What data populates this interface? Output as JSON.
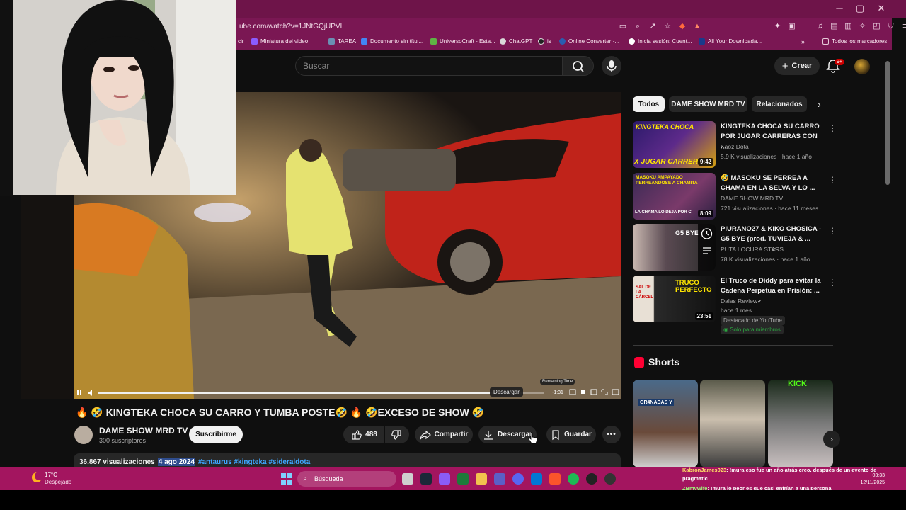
{
  "browser": {
    "url": "ube.com/watch?v=1JNtGQjUPVI",
    "bookmarks": [
      {
        "label": "cir",
        "color": "#ff5c8a"
      },
      {
        "label": "Miniatura del video",
        "color": "#8a5cff"
      },
      {
        "label": "TAREA",
        "color": "#6b8fb3"
      },
      {
        "label": "Documento sin títul...",
        "color": "#4285f4"
      },
      {
        "label": "UniversoCraft - Esta...",
        "color": "#5fb344"
      },
      {
        "label": "ChatGPT",
        "color": "#d8d8d8"
      },
      {
        "label": "is",
        "color": "#222222"
      },
      {
        "label": "Online Converter -...",
        "color": "#2a5db0"
      },
      {
        "label": "Inicia sesión: Cuent...",
        "color": "#ffffff"
      },
      {
        "label": "All Your Downloada...",
        "color": "#1a3a8a"
      },
      {
        "label": "Todos los marcadores",
        "color": "#e6c9d8"
      }
    ],
    "window_controls": {
      "minimize": "─",
      "maximize": "▢",
      "close": "✕"
    }
  },
  "header": {
    "search_placeholder": "Buscar",
    "create_label": "Crear",
    "notification_badge": "9+"
  },
  "player": {
    "tooltip_remaining": "Remaining Time",
    "time_remaining": "-1:31",
    "download_tooltip": "Descargar",
    "progress": 0.88
  },
  "video": {
    "title": "🔥 🤣 KINGTEKA CHOCA SU CARRO Y TUMBA POSTE🤣 🔥 🤣EXCESO DE SHOW 🤣",
    "channel": "DAME SHOW MRD TV",
    "subscribers": "300 suscriptores",
    "subscribe_label": "Suscribirme",
    "likes": "488",
    "share_label": "Compartir",
    "download_label": "Descargar",
    "save_label": "Guardar",
    "views": "36.867 visualizaciones",
    "date": "4 ago 2024",
    "hashtags": "#antaurus #kingteka #sideraldota"
  },
  "sidebar": {
    "chips": [
      "Todos",
      "DAME SHOW MRD TV",
      "Relacionados"
    ],
    "recommendations": [
      {
        "title": "KINGTEKA CHOCA SU CARRO POR JUGAR CARRERAS CON ...",
        "channel": "Kaoz Dota",
        "meta": "5,9 K visualizaciones · hace 1 año",
        "duration": "9:42",
        "thumb_text": "KINGTEKA CHOCA",
        "thumb_text2": "X JUGAR CARRER"
      },
      {
        "title": "🤣 MASOKU SE PERREA A CHAMA EN LA SELVA Y LO ...",
        "channel": "DAME SHOW MRD TV",
        "meta": "721 visualizaciones · hace 11 meses",
        "duration": "8:09",
        "thumb_text": "MASOKU AMPAYADO PERREANDOSE A CHAMITA",
        "thumb_text2": "LA CHAMA LO DEJA POR CI"
      },
      {
        "title": "PIURANO27 & KIKO CHOSICA - G5 BYE (prod. TUVIEJA & ...",
        "channel": "PUTA LOCURA STARS",
        "meta": "78 K visualizaciones · hace 1 año",
        "duration": "",
        "thumb_text": "G5 BYE",
        "thumb_text2": ""
      },
      {
        "title": "El Truco de Diddy para evitar la Cadena Perpetua en Prisión: ...",
        "channel": "Dalas Review",
        "meta": "hace 1 mes",
        "duration": "23:51",
        "thumb_text": "TRUCO PERFECTO",
        "thumb_text2": "SAL DE LA CÁRCEL",
        "badge1": "Destacado de YouTube",
        "badge2": "Solo para miembros"
      }
    ],
    "shorts_label": "Shorts",
    "shorts": [
      {
        "text": "GR4NADAS Y"
      },
      {
        "text": ""
      },
      {
        "text": "KICK"
      }
    ]
  },
  "taskbar": {
    "temperature": "17°C",
    "weather": "Despejado",
    "search_label": "Búsqueda",
    "time": "03:33",
    "date": "12/11/2025",
    "chat": [
      {
        "user": "KabronJames023",
        "text": ": !mura eso fue un año atrás creo. después de un evento de"
      },
      {
        "user": "",
        "text": "pragmatic"
      },
      {
        "user": "ZBmywife",
        "text": ": !mura lo peor es que casi enfrían a una persona"
      }
    ]
  },
  "colors": {
    "browser_bar": "#7a1753",
    "taskbar": "#a3155f",
    "accent_red": "#ff0033",
    "link_blue": "#3ea6ff"
  }
}
